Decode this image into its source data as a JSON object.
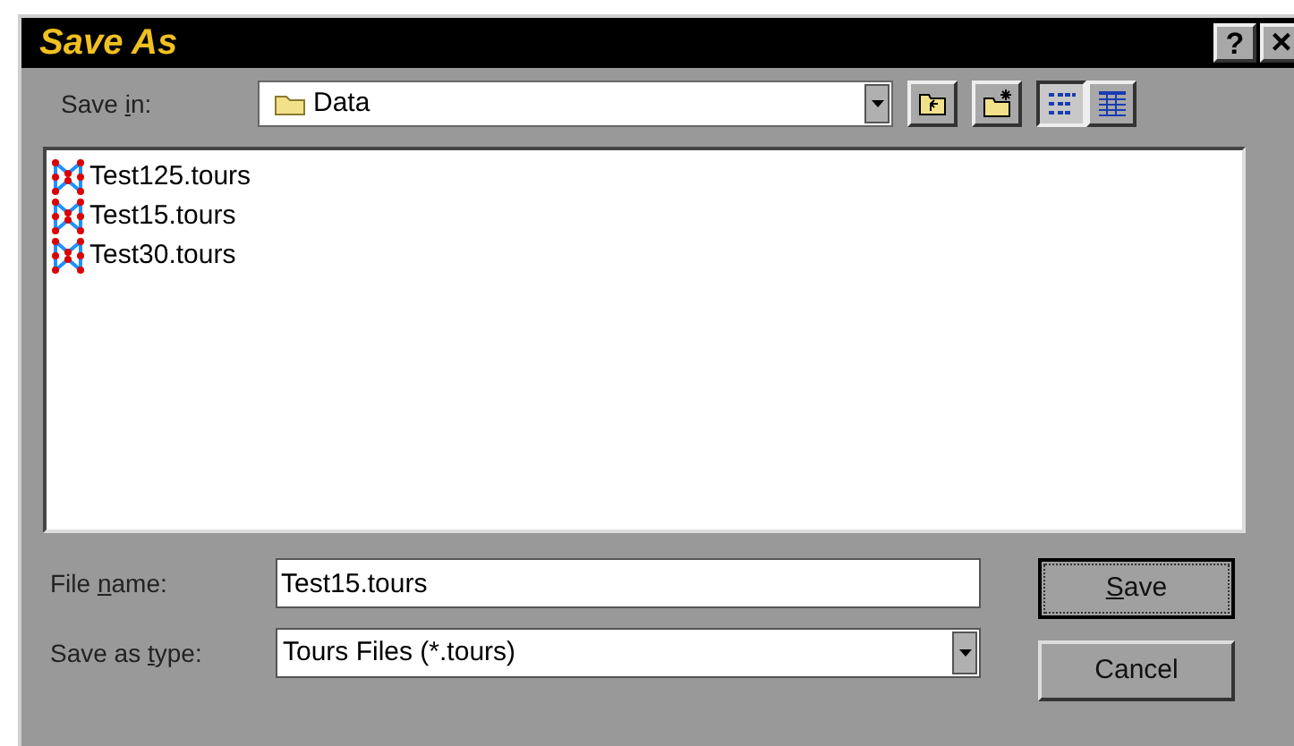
{
  "window": {
    "title": "Save As",
    "title_buttons": [
      {
        "kind": "help",
        "label": "?"
      },
      {
        "kind": "close",
        "label": "×"
      }
    ]
  },
  "save_in": {
    "label": {
      "before": "Save ",
      "key": "i",
      "after": "n:"
    },
    "value": "Data"
  },
  "toolbar": [
    {
      "kind": "up-folder"
    },
    {
      "kind": "new-folder"
    },
    {
      "kind": "list-view",
      "selected": true
    },
    {
      "kind": "details-view",
      "selected": false
    }
  ],
  "files": [
    {
      "name": "Test125.tours"
    },
    {
      "name": "Test15.tours"
    },
    {
      "name": "Test30.tours"
    }
  ],
  "file_name": {
    "label": {
      "before": "File ",
      "key": "n",
      "after": "ame:"
    },
    "value": "Test15.tours"
  },
  "save_as_type": {
    "label": {
      "before": "Save as ",
      "key": "t",
      "after": "ype:"
    },
    "value": "Tours Files (*.tours)"
  },
  "buttons": [
    {
      "label": {
        "key": "S",
        "after": "ave"
      },
      "default": true
    },
    {
      "label": {
        "before": "Cancel"
      },
      "default": false
    }
  ]
}
